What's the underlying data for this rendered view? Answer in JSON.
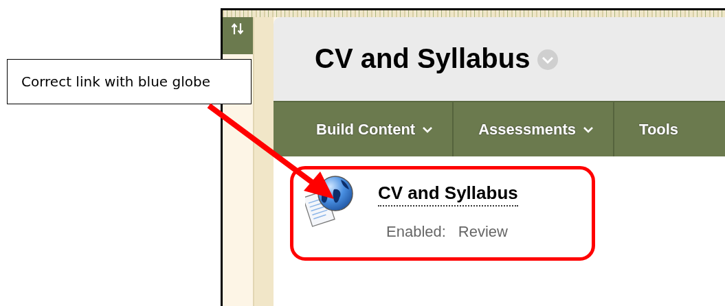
{
  "callout": {
    "text": "Correct link with blue globe"
  },
  "page": {
    "title": "CV and Syllabus",
    "nav": [
      {
        "label": "Build Content",
        "menu": true
      },
      {
        "label": "Assessments",
        "menu": true
      },
      {
        "label": "Tools",
        "menu": false
      }
    ],
    "item": {
      "title": "CV and Syllabus",
      "status_label": "Enabled:",
      "status_value": "Review",
      "highlighted": true
    }
  }
}
